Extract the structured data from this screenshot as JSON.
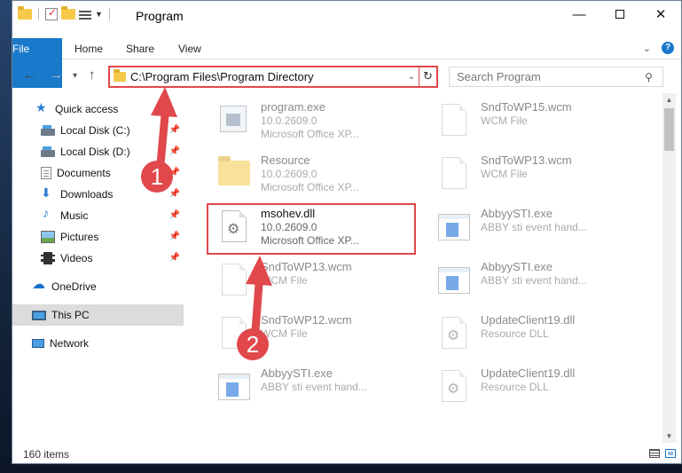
{
  "window": {
    "title": "Program",
    "controls": {
      "minimize": "—",
      "maximize": "",
      "close": "✕"
    }
  },
  "ribbon": {
    "tabs": [
      "File",
      "Home",
      "Share",
      "View"
    ]
  },
  "address": {
    "path": "C:\\Program Files\\Program Directory",
    "search_placeholder": "Search Program"
  },
  "nav": {
    "items": [
      {
        "label": "Quick access",
        "icon": "star-icon"
      },
      {
        "label": "Local Disk (C:)",
        "icon": "disk-icon",
        "pinned": true
      },
      {
        "label": "Local Disk (D:)",
        "icon": "disk-icon",
        "pinned": true
      },
      {
        "label": "Documents",
        "icon": "documents-icon",
        "pinned": true
      },
      {
        "label": "Downloads",
        "icon": "downloads-icon",
        "pinned": true
      },
      {
        "label": "Music",
        "icon": "music-icon",
        "pinned": true
      },
      {
        "label": "Pictures",
        "icon": "pictures-icon",
        "pinned": true
      },
      {
        "label": "Videos",
        "icon": "videos-icon",
        "pinned": true
      },
      {
        "label": "OneDrive",
        "icon": "onedrive-icon"
      },
      {
        "label": "This PC",
        "icon": "pc-icon",
        "selected": true
      },
      {
        "label": "Network",
        "icon": "network-icon"
      }
    ]
  },
  "files": {
    "left": [
      {
        "name": "program.exe",
        "line2": "10.0.2609.0",
        "line3": "Microsoft Office XP...",
        "icon": "exe-icon"
      },
      {
        "name": "Resource",
        "line2": "10.0.2609.0",
        "line3": "Microsoft Office XP...",
        "icon": "folder-icon"
      },
      {
        "name": "msohev.dll",
        "line2": "10.0.2609.0",
        "line3": "Microsoft Office XP...",
        "icon": "dll-icon"
      },
      {
        "name": "SndToWP13.wcm",
        "line2": "WCM File",
        "line3": "",
        "icon": "file-icon"
      },
      {
        "name": "SndToWP12.wcm",
        "line2": "WCM File",
        "line3": "",
        "icon": "file-icon"
      },
      {
        "name": "AbbyySTI.exe",
        "line2": "ABBY sti event hand...",
        "line3": "",
        "icon": "app-icon"
      }
    ],
    "right": [
      {
        "name": "SndToWP15.wcm",
        "line2": "WCM File",
        "icon": "file-icon"
      },
      {
        "name": "SndToWP13.wcm",
        "line2": "WCM File",
        "icon": "file-icon"
      },
      {
        "name": "AbbyySTI.exe",
        "line2": "ABBY sti event hand...",
        "icon": "app-icon"
      },
      {
        "name": "AbbyySTI.exe",
        "line2": "ABBY sti event hand...",
        "icon": "app-icon"
      },
      {
        "name": "UpdateClient19.dll",
        "line2": "Resource DLL",
        "icon": "dll-icon"
      },
      {
        "name": "UpdateClient19.dll",
        "line2": "Resource DLL",
        "icon": "dll-icon"
      }
    ]
  },
  "status": {
    "count": "160 items"
  },
  "annotations": {
    "step1": "1",
    "step2": "2",
    "color": "#e0484c"
  }
}
